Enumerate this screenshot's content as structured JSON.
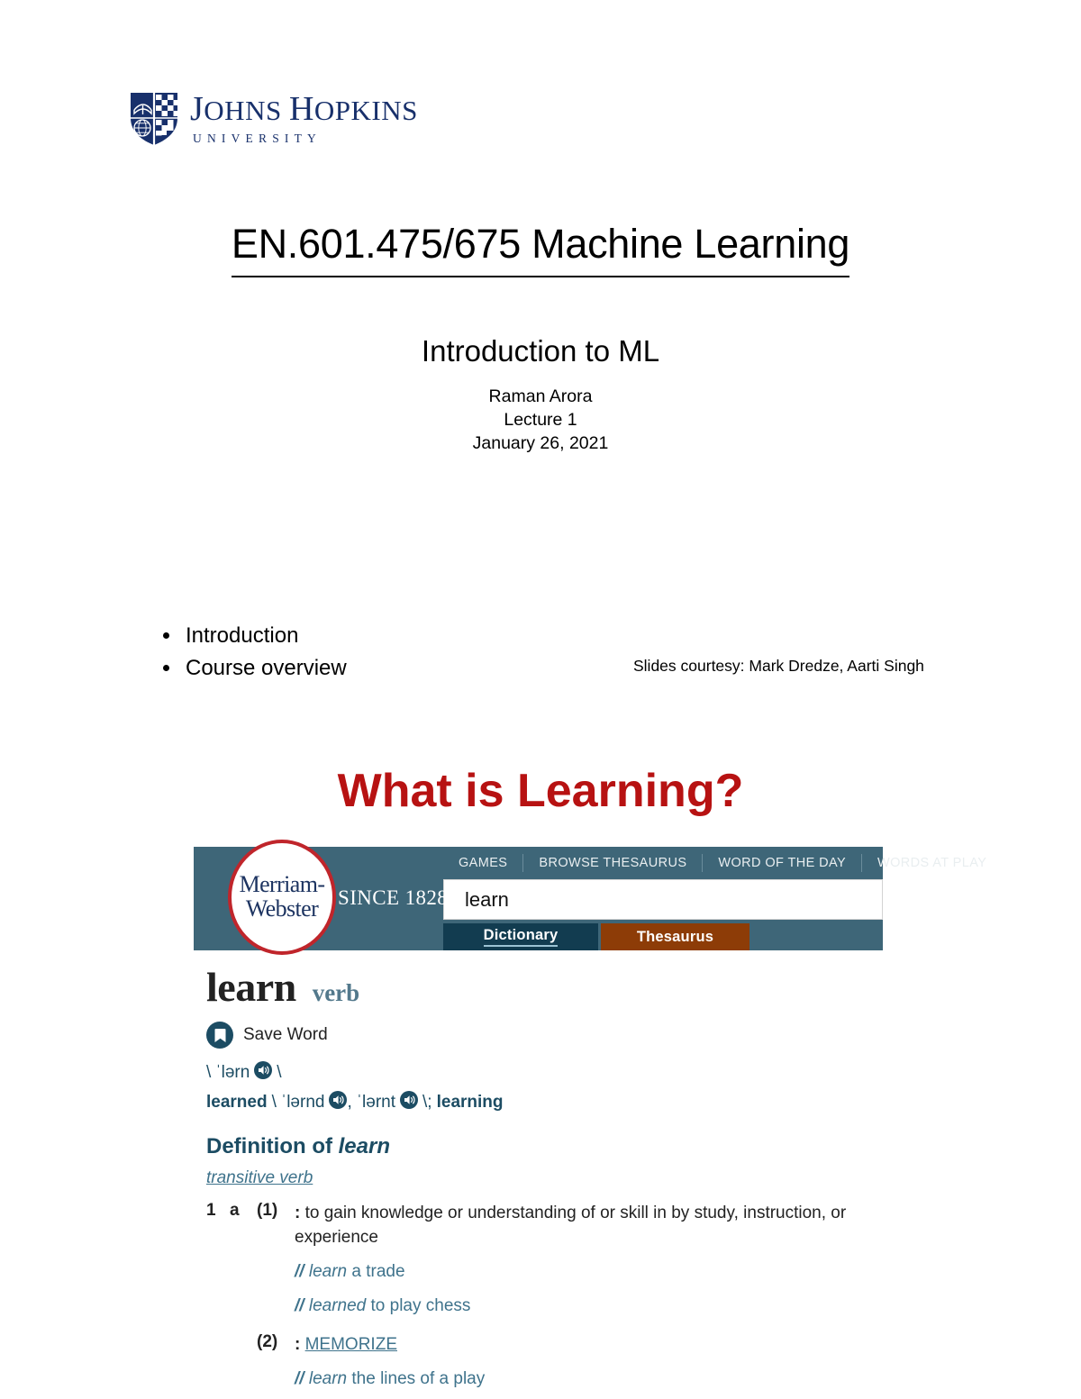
{
  "slide1": {
    "logo": {
      "name_part1": "J",
      "name_part2": "OHNS ",
      "name_part3": "H",
      "name_part4": "OPKINS",
      "university": "UNIVERSITY",
      "color": "#18306b"
    },
    "course_title": "EN.601.475/675 Machine Learning",
    "subtitle": "Introduction to ML",
    "byline": {
      "instructor": "Raman Arora",
      "lecture": "Lecture 1",
      "date": "January 26, 2021"
    },
    "bullets": [
      "Introduction",
      "Course overview"
    ],
    "credit": "Slides courtesy: Mark Dredze, Aarti Singh"
  },
  "slide2": {
    "title": "What is Learning?",
    "title_color": "#b71212",
    "merriam_webster": {
      "header_color": "#3e6678",
      "logo_line1": "Merriam-",
      "logo_line2": "Webster",
      "since": "SINCE 1828",
      "nav": [
        "GAMES",
        "BROWSE THESAURUS",
        "WORD OF THE DAY",
        "WORDS AT PLAY"
      ],
      "search_value": "learn",
      "tabs": [
        {
          "label": "Dictionary",
          "active": true,
          "color": "#123c50"
        },
        {
          "label": "Thesaurus",
          "active": false,
          "color": "#8d3c07"
        }
      ],
      "entry": {
        "headword": "learn",
        "part_of_speech": "verb",
        "save_word_label": "Save Word",
        "save_word_icon": "bookmark-icon",
        "pronunciation": {
          "open": "\\",
          "phonetic": "ˈlərn",
          "close": "\\"
        },
        "inflections": {
          "learned_label": "learned",
          "open": "\\",
          "phonetic1": "ˈlərnd",
          "comma": ",",
          "phonetic2": "ˈlərnt",
          "close": "\\;",
          "learning_label": "learning"
        },
        "definition_heading_prefix": "Definition of ",
        "definition_heading_word": "learn",
        "verb_type": "transitive verb",
        "senses": [
          {
            "number": "1",
            "letter": "a",
            "sub": "(1)",
            "colon": ":",
            "text": "to gain knowledge or understanding of or skill in by study, instruction, or experience",
            "examples": [
              {
                "slashes": "//",
                "italic": "learn",
                "rest": " a trade"
              },
              {
                "slashes": "//",
                "italic": "learned",
                "rest": " to play chess"
              }
            ]
          },
          {
            "sub": "(2)",
            "colon": ":",
            "xref": "MEMORIZE",
            "examples": [
              {
                "slashes": "//",
                "italic": "learn",
                "rest": " the lines of a play"
              }
            ]
          }
        ]
      }
    }
  }
}
